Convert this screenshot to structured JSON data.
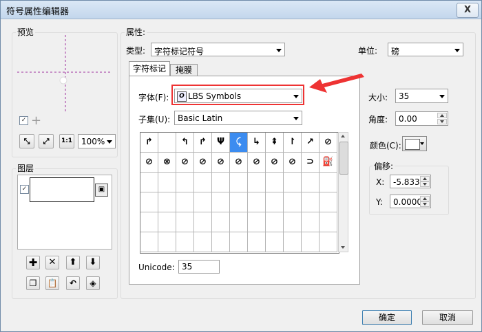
{
  "window": {
    "title": "符号属性编辑器",
    "close_glyph": "X"
  },
  "preview": {
    "label": "预览",
    "checkbox_checked": true,
    "zoom_value": "100%"
  },
  "layers": {
    "label": "图层"
  },
  "properties": {
    "label": "属性:",
    "type_label": "类型:",
    "type_value": "字符标记符号",
    "unit_label": "单位:",
    "unit_value": "磅",
    "tabs": [
      "字符标记",
      "掩膜"
    ],
    "font_label": "字体(F):",
    "font_value": "LBS Symbols",
    "subset_label": "子集(U):",
    "subset_value": "Basic Latin",
    "unicode_label": "Unicode:",
    "unicode_value": "35",
    "size_label": "大小:",
    "size_value": "35",
    "angle_label": "角度:",
    "angle_value": "0.00",
    "color_label": "颜色(C):",
    "offset_label": "偏移:",
    "x_label": "X:",
    "x_value": "-5.8333",
    "y_label": "Y:",
    "y_value": "0.0000"
  },
  "glyph_rows": [
    [
      "↱",
      "",
      "↰",
      "↱",
      "Ψ",
      "⤹",
      "↳",
      "⇞",
      "↾",
      "↗",
      "⊘"
    ],
    [
      "⊘",
      "⊗",
      "⊘",
      "⊘",
      "⊘",
      "⊘",
      "⊘",
      "⊘",
      "⊘",
      "⊃",
      "⛽"
    ]
  ],
  "selected_glyph": {
    "row": 0,
    "col": 5
  },
  "buttons": {
    "ok": "确定",
    "cancel": "取消"
  },
  "accent_colors": {
    "selection": "#3c8cf0",
    "highlight_box": "#ee3333",
    "arrow": "#ee3333"
  }
}
